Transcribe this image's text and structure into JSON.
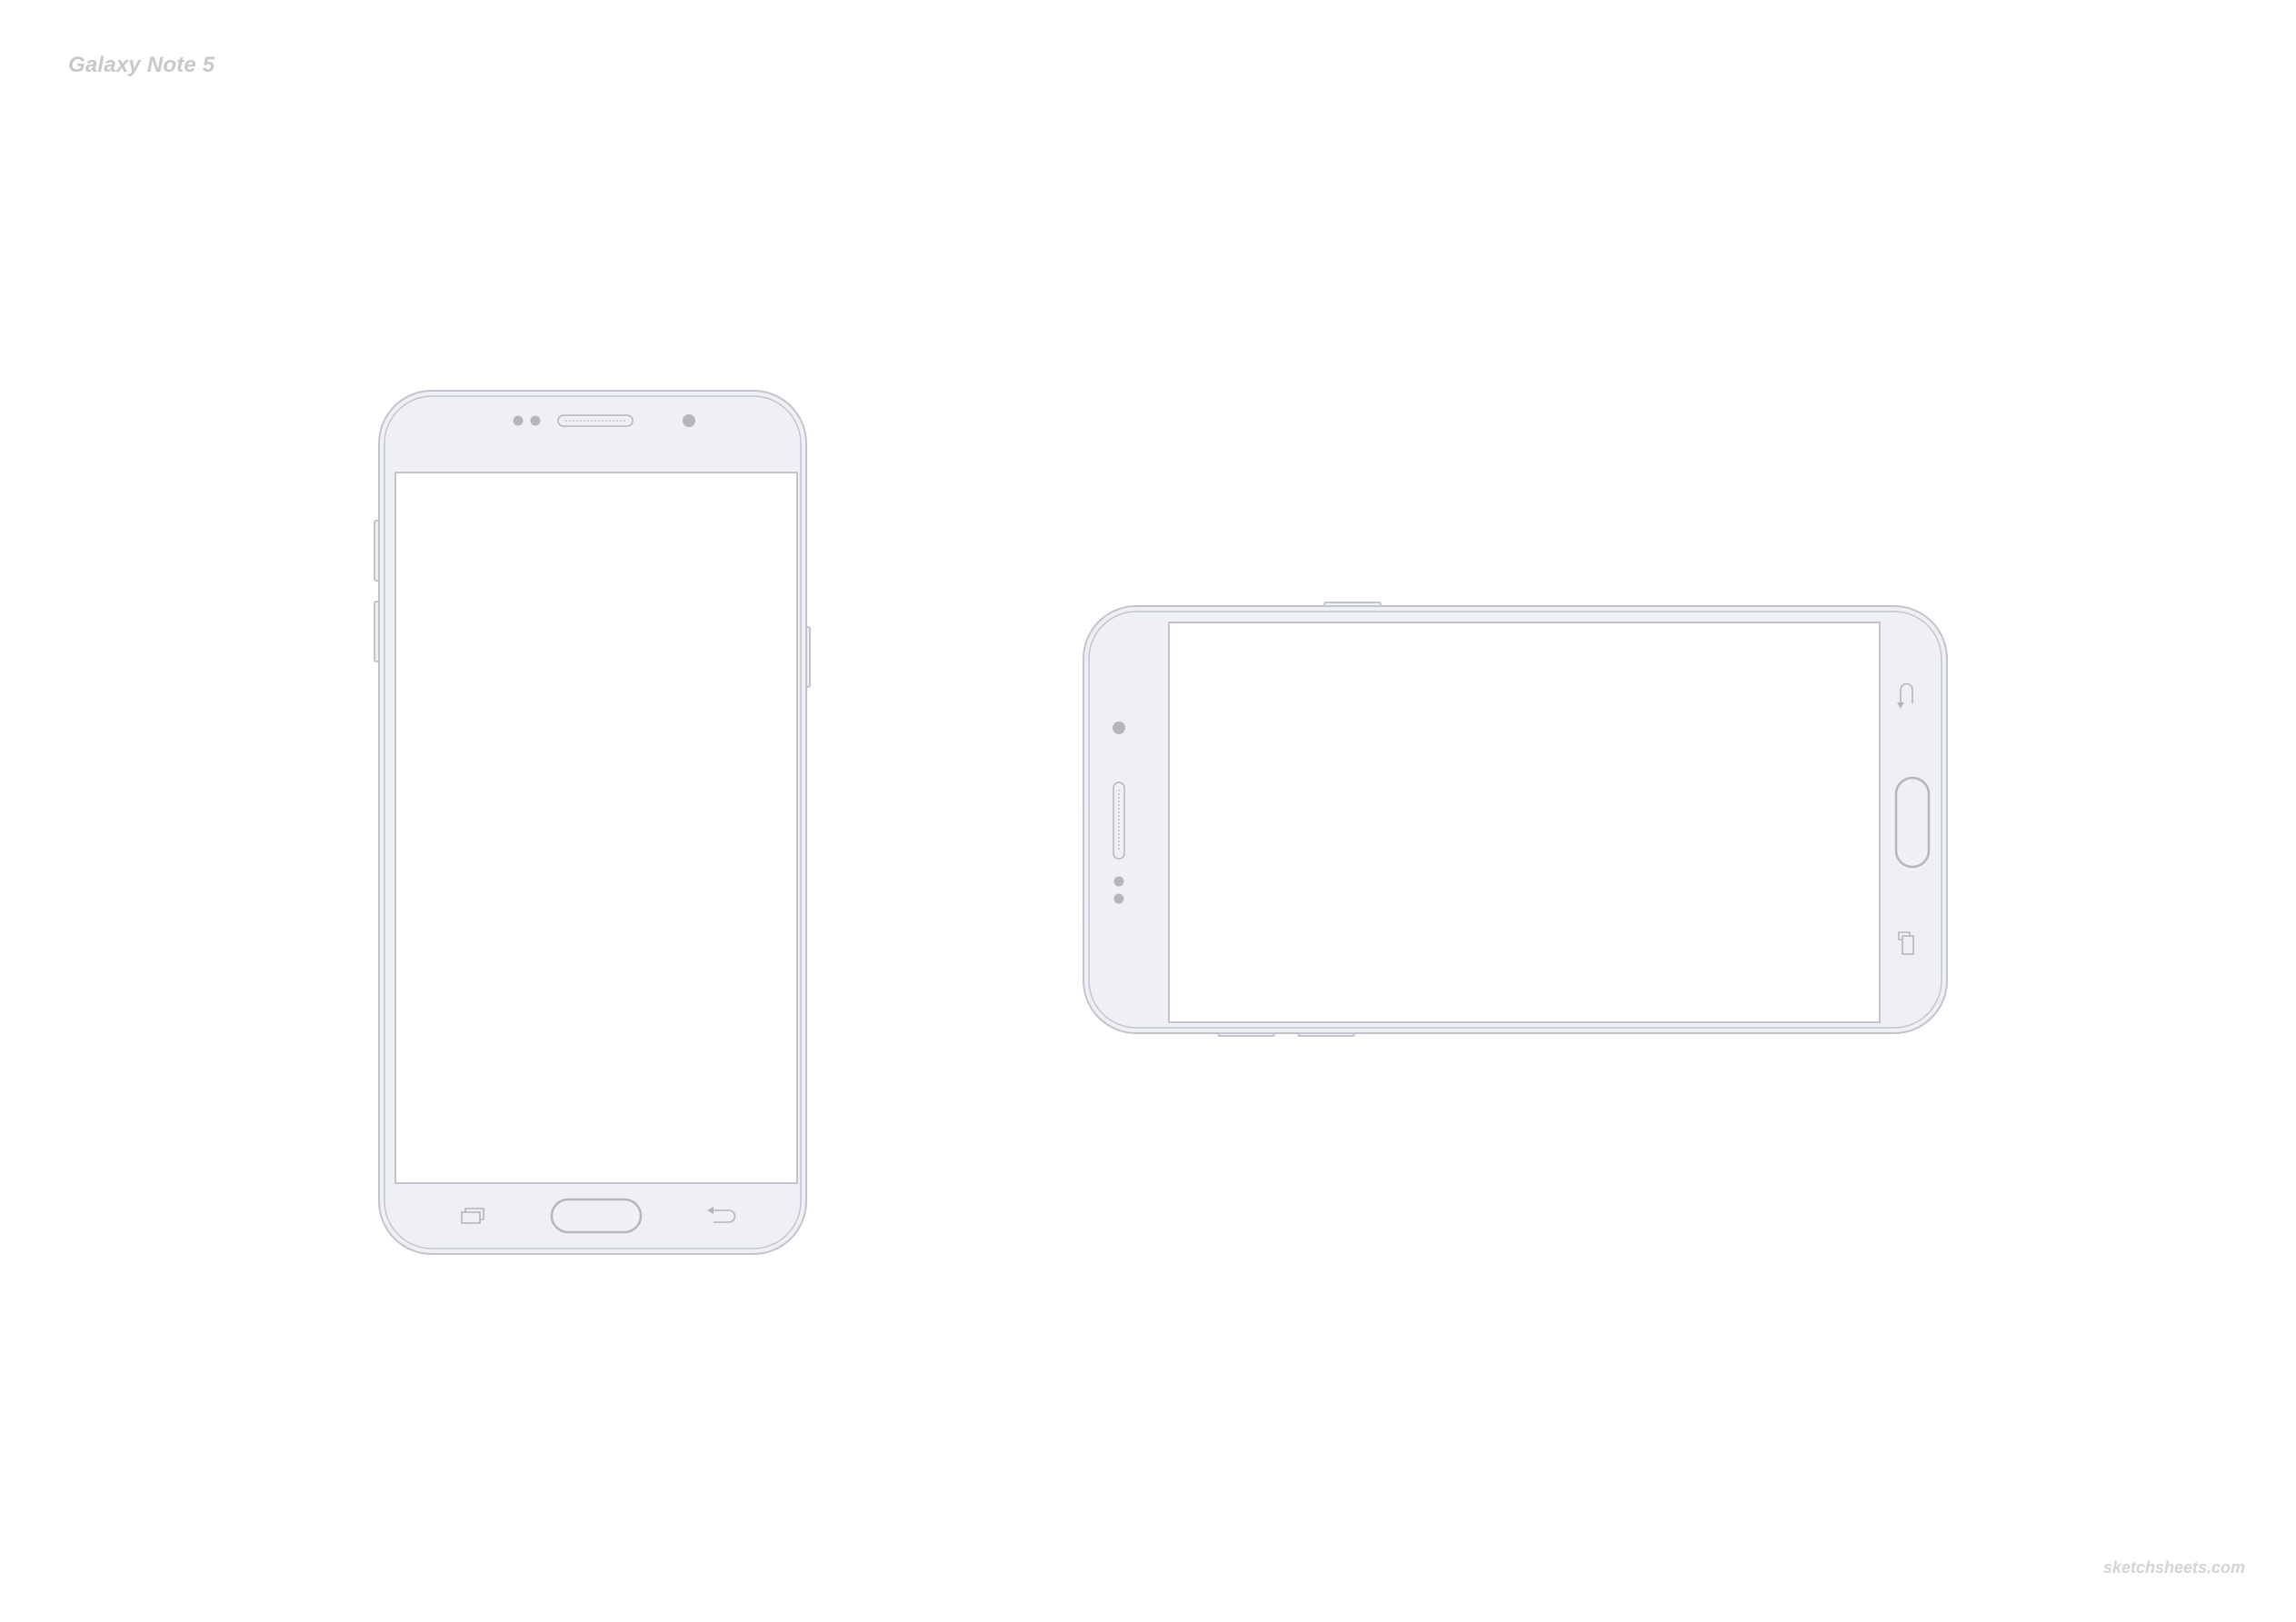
{
  "page": {
    "title": "Galaxy Note 5",
    "footer": "sketchsheets.com"
  },
  "devices": [
    {
      "orientation": "portrait"
    },
    {
      "orientation": "landscape"
    }
  ],
  "colors": {
    "body_fill": "#eff0f4",
    "outline": "#c3c5cd",
    "sensor": "#b5b6ba",
    "screen": "#ffffff",
    "label": "#c7c9cc"
  }
}
